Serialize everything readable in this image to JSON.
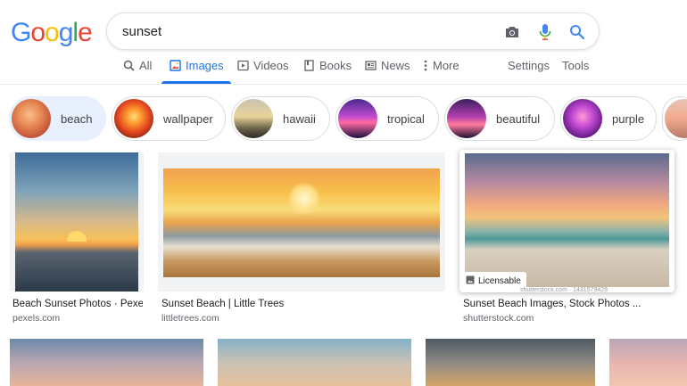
{
  "logo": {
    "letters": [
      "G",
      "o",
      "o",
      "g",
      "l",
      "e"
    ]
  },
  "search": {
    "query": "sunset",
    "icons": [
      "camera-icon",
      "microphone-icon",
      "search-icon"
    ]
  },
  "tabs": [
    {
      "label": "All",
      "icon": "search-icon"
    },
    {
      "label": "Images",
      "icon": "image-icon",
      "active": true
    },
    {
      "label": "Videos",
      "icon": "play-icon"
    },
    {
      "label": "Books",
      "icon": "book-icon"
    },
    {
      "label": "News",
      "icon": "news-icon"
    },
    {
      "label": "More",
      "icon": "more-vertical-icon"
    }
  ],
  "tools": {
    "settings": "Settings",
    "tools": "Tools"
  },
  "chips": [
    {
      "label": "beach",
      "selected": true
    },
    {
      "label": "wallpaper"
    },
    {
      "label": "hawaii"
    },
    {
      "label": "tropical"
    },
    {
      "label": "beautiful"
    },
    {
      "label": "purple"
    }
  ],
  "results": [
    {
      "title": "Beach Sunset Photos · Pexe...",
      "source": "pexels.com"
    },
    {
      "title": "Sunset Beach | Little Trees",
      "source": "littletrees.com"
    },
    {
      "title": "Sunset Beach Images, Stock Photos ...",
      "source": "shutterstock.com",
      "badge": "Licensable",
      "watermark": "shutterstock.com · 1431579428"
    }
  ],
  "colors": {
    "accent": "#1a73e8",
    "logo": [
      "#4285f4",
      "#ea4335",
      "#fbbc05",
      "#4285f4",
      "#34a853",
      "#ea4335"
    ]
  }
}
